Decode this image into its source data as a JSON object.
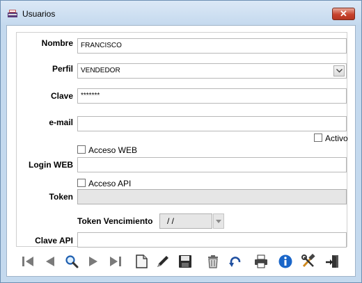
{
  "window": {
    "title": "Usuarios",
    "close_label": "✕"
  },
  "form": {
    "nombre": {
      "label": "Nombre",
      "value": "FRANCISCO"
    },
    "perfil": {
      "label": "Perfil",
      "value": "VENDEDOR"
    },
    "clave": {
      "label": "Clave",
      "value": "*******"
    },
    "email": {
      "label": "e-mail",
      "value": ""
    },
    "activo": {
      "label": "Activo",
      "checked": false
    },
    "acceso_web": {
      "label": "Acceso WEB",
      "checked": false
    },
    "login_web": {
      "label": "Login WEB",
      "value": ""
    },
    "acceso_api": {
      "label": "Acceso API",
      "checked": false
    },
    "token": {
      "label": "Token",
      "value": ""
    },
    "token_vencimiento": {
      "label": "Token Vencimiento",
      "value": "/  /"
    },
    "clave_api": {
      "label": "Clave API",
      "value": ""
    }
  },
  "toolbar": {
    "icons": [
      "first-record-icon",
      "previous-record-icon",
      "search-icon",
      "next-record-icon",
      "last-record-icon",
      "new-document-icon",
      "edit-pencil-icon",
      "save-floppy-icon",
      "delete-trash-icon",
      "undo-icon",
      "print-icon",
      "info-icon",
      "tools-icon",
      "exit-door-icon"
    ]
  },
  "colors": {
    "frame": "#c4d9ee",
    "close": "#c7432d",
    "nav_gray": "#7a7a7a",
    "info_blue": "#1a66c9"
  }
}
